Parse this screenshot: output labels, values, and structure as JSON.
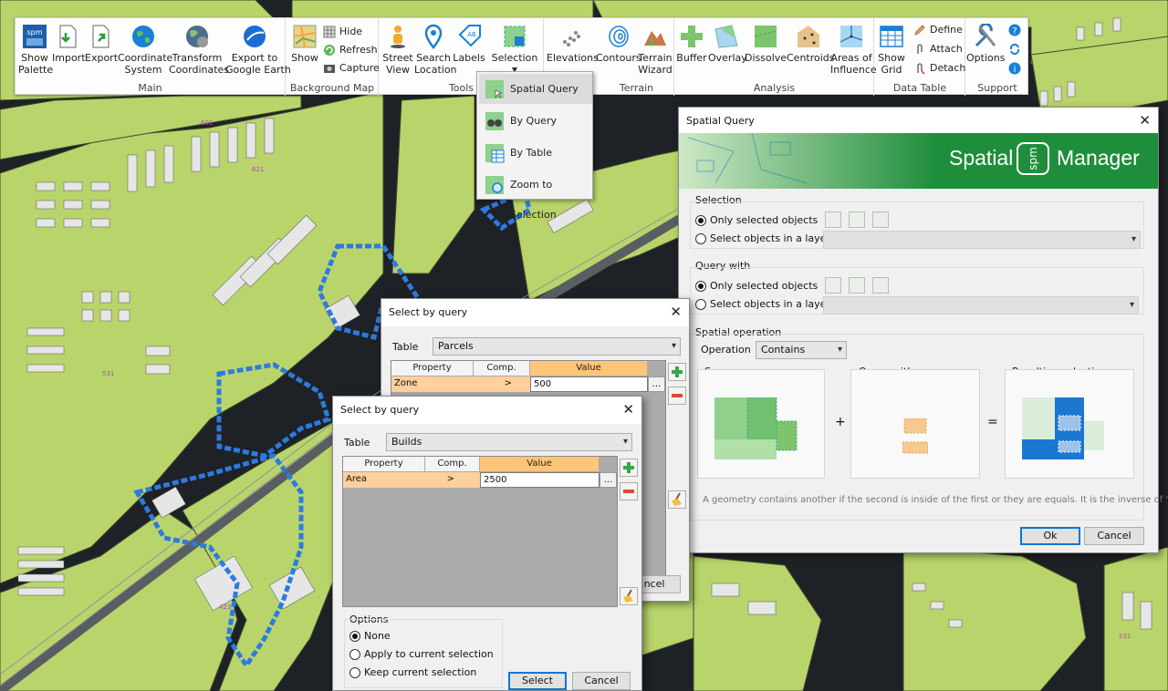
{
  "ribbon": {
    "groups": {
      "main": "Main",
      "background_map": "Background Map",
      "tools": "Tools",
      "terrain": "Terrain",
      "analysis": "Analysis",
      "data_table": "Data Table",
      "support": "Support"
    },
    "buttons": {
      "show_palette": "Show\nPalette",
      "import": "Import",
      "export": "Export",
      "coordinate_system": "Coordinate\nSystem",
      "transform_coordinates": "Transform\nCoordinates",
      "export_google_earth": "Export to\nGoogle Earth",
      "show": "Show",
      "hide": "Hide",
      "refresh": "Refresh",
      "capture": "Capture",
      "street_view": "Street\nView",
      "search_location": "Search\nLocation",
      "labels": "Labels",
      "selection": "Selection",
      "elevations": "Elevations",
      "contours": "Contours",
      "terrain_wizard": "Terrain\nWizard",
      "buffer": "Buffer",
      "overlay": "Overlay",
      "dissolve": "Dissolve",
      "centroids": "Centroids",
      "areas_of_influence": "Areas of\nInfluence",
      "show_grid": "Show\nGrid",
      "define": "Define",
      "attach": "Attach",
      "detach": "Detach",
      "options": "Options"
    },
    "spm_label": "spm"
  },
  "selection_menu": {
    "items": [
      "Spatial Query",
      "By Query",
      "By Table",
      "Zoom to Selection"
    ]
  },
  "spatial_query": {
    "title": "Spatial Query",
    "banner_left": "Spatial",
    "banner_badge": "spm",
    "banner_right": "Manager",
    "selection_label": "Selection",
    "selection_opt1": "Only selected objects",
    "selection_opt2": "Select objects in a layer",
    "query_with_label": "Query with",
    "query_opt1": "Only selected objects",
    "query_opt2": "Select objects in a layer",
    "spatial_operation_label": "Spatial operation",
    "operation_label": "Operation",
    "operation_value": "Contains",
    "source_label": "Source",
    "query_with_panel": "Query with",
    "resulting_label": "Resulting selection",
    "plus": "+",
    "equals": "=",
    "description": "A geometry contains another if the second is inside of the first or they are equals. It is the inverse of 'Within'",
    "ok": "Ok",
    "cancel": "Cancel",
    "colors": {
      "banner": "#1f8e3c",
      "source": "#8fd08c",
      "query": "#f8c98c",
      "result": "#1b78d0"
    }
  },
  "query_dialog_back": {
    "title": "Select by query",
    "table_label": "Table",
    "table_value": "Parcels",
    "columns": [
      "Property",
      "Comp.",
      "Value"
    ],
    "row": {
      "property": "Zone",
      "comp": ">",
      "value": "500"
    },
    "dots": "...",
    "cancel_partial": "ncel"
  },
  "query_dialog_front": {
    "title": "Select by query",
    "table_label": "Table",
    "table_value": "Builds",
    "columns": [
      "Property",
      "Comp.",
      "Value"
    ],
    "row": {
      "property": "Area",
      "comp": ">",
      "value": "2500"
    },
    "dots": "...",
    "options_label": "Options",
    "opt_none": "None",
    "opt_apply": "Apply to current selection",
    "opt_keep": "Keep current selection",
    "select": "Select",
    "cancel": "Cancel"
  },
  "map_labels": [
    "601",
    "621",
    "531",
    "423",
    "531",
    "441"
  ]
}
